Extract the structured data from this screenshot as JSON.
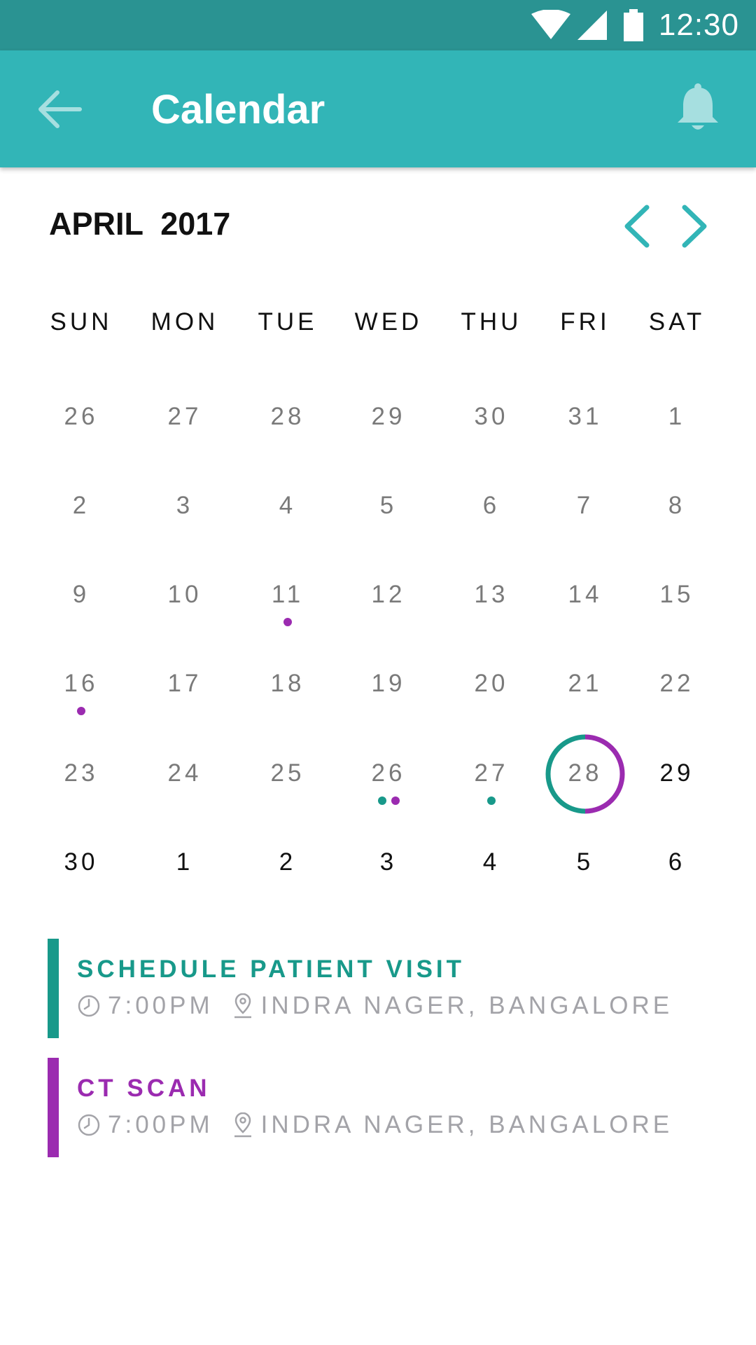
{
  "colors": {
    "status_bar": "#2a9392",
    "app_bar": "#32b5b7",
    "accent_teal": "#18998a",
    "accent_purple": "#9b2bb0",
    "muted_text": "#a3a3a8"
  },
  "status_bar": {
    "time": "12:30",
    "icons": [
      "wifi-icon",
      "signal-icon",
      "battery-icon"
    ]
  },
  "app_bar": {
    "title": "Calendar",
    "back_icon": "arrow-left-icon",
    "action_icon": "bell-icon"
  },
  "calendar": {
    "month_label": "APRIL  2017",
    "prev_icon": "chevron-left-icon",
    "next_icon": "chevron-right-icon",
    "weekdays": [
      "SUN",
      "MON",
      "TUE",
      "WED",
      "THU",
      "FRI",
      "SAT"
    ],
    "weeks": [
      [
        {
          "day": "26",
          "state": "past"
        },
        {
          "day": "27",
          "state": "past"
        },
        {
          "day": "28",
          "state": "past"
        },
        {
          "day": "29",
          "state": "past"
        },
        {
          "day": "30",
          "state": "past"
        },
        {
          "day": "31",
          "state": "past"
        },
        {
          "day": "1",
          "state": "past"
        }
      ],
      [
        {
          "day": "2",
          "state": "past"
        },
        {
          "day": "3",
          "state": "past"
        },
        {
          "day": "4",
          "state": "past"
        },
        {
          "day": "5",
          "state": "past"
        },
        {
          "day": "6",
          "state": "past"
        },
        {
          "day": "7",
          "state": "past"
        },
        {
          "day": "8",
          "state": "past"
        }
      ],
      [
        {
          "day": "9",
          "state": "past"
        },
        {
          "day": "10",
          "state": "past"
        },
        {
          "day": "11",
          "state": "past",
          "dots": [
            "purple"
          ]
        },
        {
          "day": "12",
          "state": "past"
        },
        {
          "day": "13",
          "state": "past"
        },
        {
          "day": "14",
          "state": "past"
        },
        {
          "day": "15",
          "state": "past"
        }
      ],
      [
        {
          "day": "16",
          "state": "past",
          "dots": [
            "purple"
          ]
        },
        {
          "day": "17",
          "state": "past"
        },
        {
          "day": "18",
          "state": "past"
        },
        {
          "day": "19",
          "state": "past"
        },
        {
          "day": "20",
          "state": "past"
        },
        {
          "day": "21",
          "state": "past"
        },
        {
          "day": "22",
          "state": "past"
        }
      ],
      [
        {
          "day": "23",
          "state": "past"
        },
        {
          "day": "24",
          "state": "past"
        },
        {
          "day": "25",
          "state": "past"
        },
        {
          "day": "26",
          "state": "past",
          "dots": [
            "teal",
            "purple"
          ]
        },
        {
          "day": "27",
          "state": "past",
          "dots": [
            "teal"
          ]
        },
        {
          "day": "28",
          "state": "selected"
        },
        {
          "day": "29",
          "state": "upcoming"
        }
      ],
      [
        {
          "day": "30",
          "state": "upcoming"
        },
        {
          "day": "1",
          "state": "next"
        },
        {
          "day": "2",
          "state": "next"
        },
        {
          "day": "3",
          "state": "next"
        },
        {
          "day": "4",
          "state": "next"
        },
        {
          "day": "5",
          "state": "next"
        },
        {
          "day": "6",
          "state": "next"
        }
      ]
    ]
  },
  "events": [
    {
      "title": "SCHEDULE PATIENT VISIT",
      "time": "7:00PM",
      "location": "INDRA NAGER, BANGALORE",
      "color": "teal"
    },
    {
      "title": "CT SCAN",
      "time": "7:00PM",
      "location": "INDRA NAGER, BANGALORE",
      "color": "purple"
    }
  ]
}
